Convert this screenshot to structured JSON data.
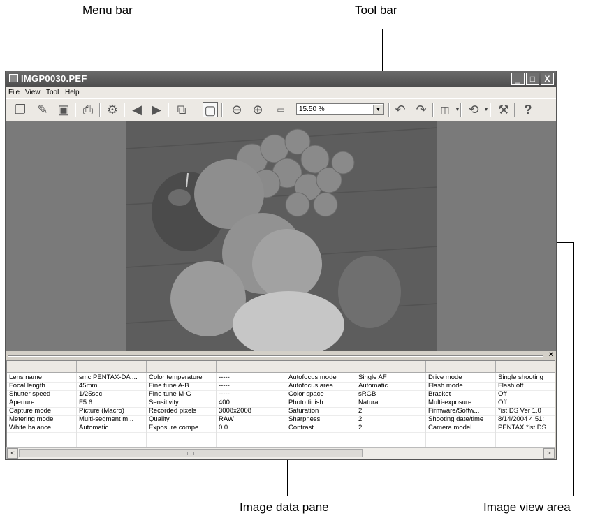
{
  "callouts": {
    "menu_bar": "Menu bar",
    "tool_bar": "Tool bar",
    "image_data_pane": "Image data pane",
    "image_view_area": "Image view area"
  },
  "window": {
    "title": "IMGP0030.PEF",
    "controls": {
      "minimize": "_",
      "maximize": "□",
      "close": "X"
    }
  },
  "menu": [
    "File",
    "View",
    "Tool",
    "Help"
  ],
  "toolbar": {
    "zoom_value": "15.50 %",
    "icons": [
      "new-window-icon",
      "open-file-icon",
      "save-icon",
      "print-icon",
      "settings-gear-icon",
      "previous-icon",
      "next-icon",
      "copy-image-icon",
      "fit-window-icon",
      "zoom-out-icon",
      "zoom-in-icon",
      "actual-size-icon",
      "rotate-left-icon",
      "rotate-right-icon",
      "display-mode-icon",
      "transform-icon",
      "tool-icon",
      "help-icon"
    ]
  },
  "image_data": {
    "rows": [
      [
        "Lens name",
        "smc PENTAX-DA ...",
        "Color temperature",
        "-----",
        "Autofocus mode",
        "Single AF",
        "Drive mode",
        "Single shooting"
      ],
      [
        "Focal length",
        "45mm",
        "Fine tune A-B",
        "-----",
        "Autofocus area ...",
        "Automatic",
        "Flash mode",
        "Flash off"
      ],
      [
        "Shutter speed",
        "1/25sec",
        "Fine tune M-G",
        "-----",
        "Color space",
        "sRGB",
        "Bracket",
        "Off"
      ],
      [
        "Aperture",
        "F5.6",
        "Sensitivity",
        "400",
        "Photo finish",
        "Natural",
        "Multi-exposure",
        "Off"
      ],
      [
        "Capture mode",
        "Picture (Macro)",
        "Recorded pixels",
        "3008x2008",
        "Saturation",
        "2",
        "Firmware/Softw...",
        "*ist DS   Ver 1.0"
      ],
      [
        "Metering mode",
        "Multi-segment m...",
        "Quality",
        "RAW",
        "Sharpness",
        "2",
        "Shooting date/time",
        "8/14/2004 4:51:"
      ],
      [
        "White balance",
        "Automatic",
        "Exposure compe...",
        "0.0",
        "Contrast",
        "2",
        "Camera model",
        "PENTAX *ist DS"
      ]
    ],
    "close_label": "×"
  },
  "scrollbar": {
    "left": "<",
    "right": ">"
  }
}
